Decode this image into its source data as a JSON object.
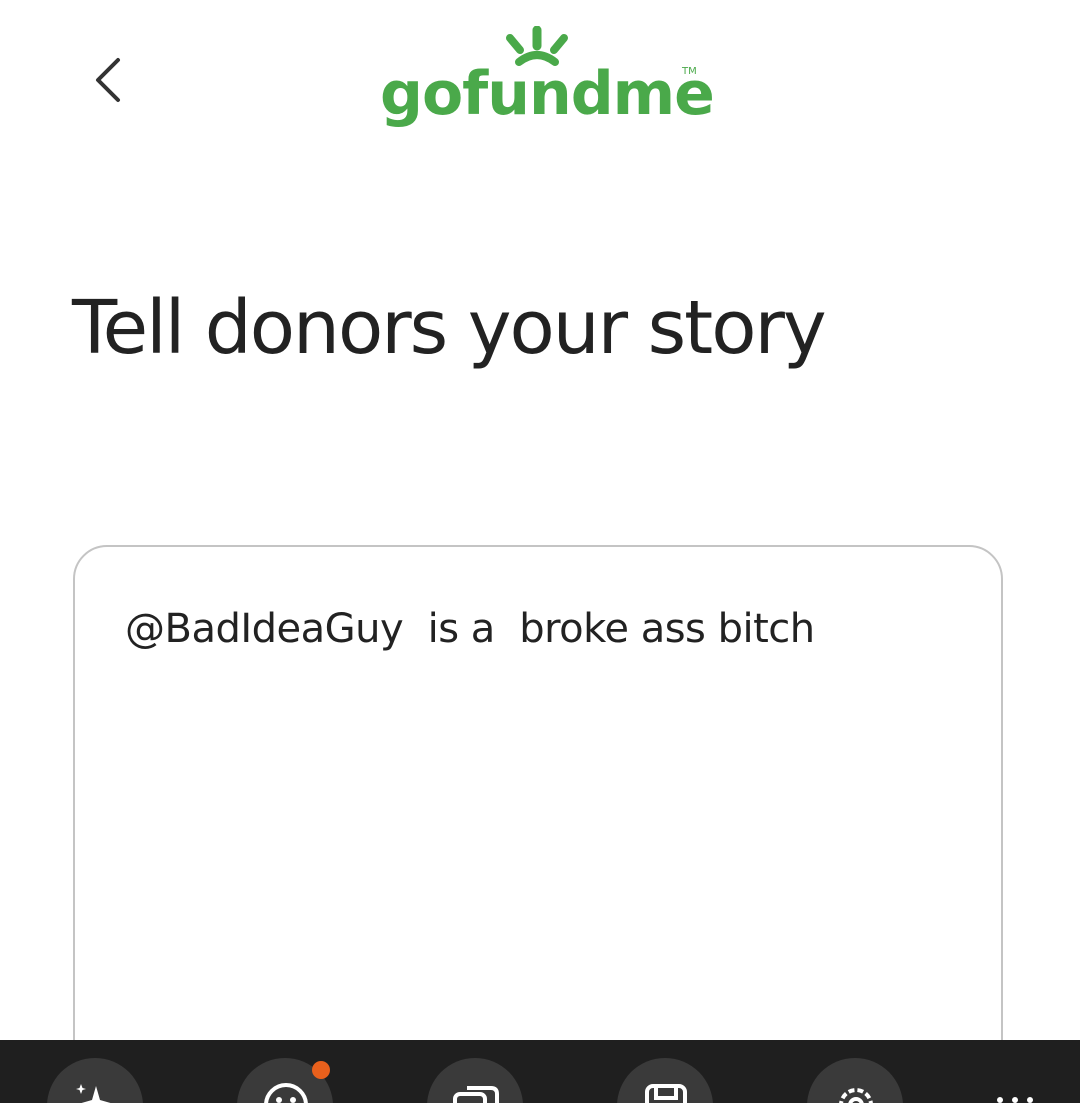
{
  "header": {
    "back_icon": "chevron-left-icon",
    "logo_text": "gofundme",
    "logo_tm": "TM",
    "brand_color": "#4aa94a"
  },
  "main": {
    "title": "Tell donors your story",
    "story_text": "@BadIdeaGuy  is a  broke ass bitch"
  },
  "toolbar": {
    "items": [
      {
        "icon": "sparkle-star-icon"
      },
      {
        "icon": "emoji-face-icon",
        "notification_color": "#e8601c"
      },
      {
        "icon": "copy-windows-icon"
      },
      {
        "icon": "save-icon"
      },
      {
        "icon": "gear-icon"
      },
      {
        "icon": "more-dots-icon"
      }
    ],
    "background": "#1f1f1f"
  }
}
